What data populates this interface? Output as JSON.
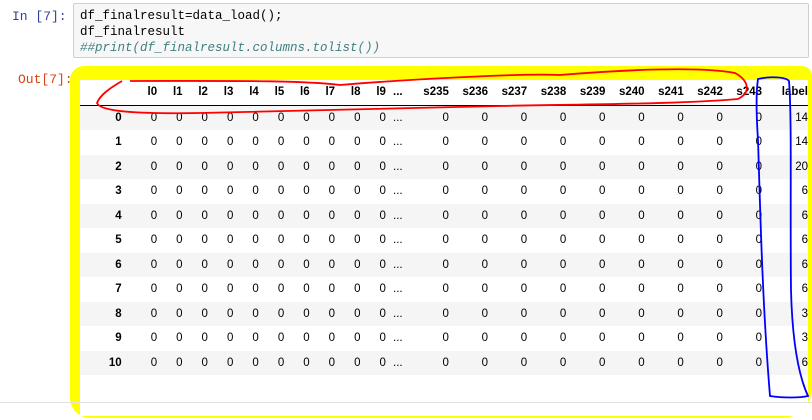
{
  "input_cell": {
    "prompt": "In  [7]:",
    "lines": [
      "df_finalresult=data_load();",
      "df_finalresult",
      "##print(df_finalresult.columns.tolist())"
    ]
  },
  "output_cell": {
    "prompt": "Out[7]:"
  },
  "dataframe": {
    "columns": [
      "l0",
      "l1",
      "l2",
      "l3",
      "l4",
      "l5",
      "l6",
      "l7",
      "l8",
      "l9",
      "...",
      "s235",
      "s236",
      "s237",
      "s238",
      "s239",
      "s240",
      "s241",
      "s242",
      "s243",
      "label"
    ],
    "index": [
      "0",
      "1",
      "2",
      "3",
      "4",
      "5",
      "6",
      "7",
      "8",
      "9",
      "10"
    ],
    "rows": [
      [
        "0",
        "0",
        "0",
        "0",
        "0",
        "0",
        "0",
        "0",
        "0",
        "0",
        "...",
        "0",
        "0",
        "0",
        "0",
        "0",
        "0",
        "0",
        "0",
        "0",
        "14"
      ],
      [
        "0",
        "0",
        "0",
        "0",
        "0",
        "0",
        "0",
        "0",
        "0",
        "0",
        "...",
        "0",
        "0",
        "0",
        "0",
        "0",
        "0",
        "0",
        "0",
        "0",
        "14"
      ],
      [
        "0",
        "0",
        "0",
        "0",
        "0",
        "0",
        "0",
        "0",
        "0",
        "0",
        "...",
        "0",
        "0",
        "0",
        "0",
        "0",
        "0",
        "0",
        "0",
        "0",
        "20"
      ],
      [
        "0",
        "0",
        "0",
        "0",
        "0",
        "0",
        "0",
        "0",
        "0",
        "0",
        "...",
        "0",
        "0",
        "0",
        "0",
        "0",
        "0",
        "0",
        "0",
        "0",
        "6"
      ],
      [
        "0",
        "0",
        "0",
        "0",
        "0",
        "0",
        "0",
        "0",
        "0",
        "0",
        "...",
        "0",
        "0",
        "0",
        "0",
        "0",
        "0",
        "0",
        "0",
        "0",
        "6"
      ],
      [
        "0",
        "0",
        "0",
        "0",
        "0",
        "0",
        "0",
        "0",
        "0",
        "0",
        "...",
        "0",
        "0",
        "0",
        "0",
        "0",
        "0",
        "0",
        "0",
        "0",
        "6"
      ],
      [
        "0",
        "0",
        "0",
        "0",
        "0",
        "0",
        "0",
        "0",
        "0",
        "0",
        "...",
        "0",
        "0",
        "0",
        "0",
        "0",
        "0",
        "0",
        "0",
        "0",
        "6"
      ],
      [
        "0",
        "0",
        "0",
        "0",
        "0",
        "0",
        "0",
        "0",
        "0",
        "0",
        "...",
        "0",
        "0",
        "0",
        "0",
        "0",
        "0",
        "0",
        "0",
        "0",
        "6"
      ],
      [
        "0",
        "0",
        "0",
        "0",
        "0",
        "0",
        "0",
        "0",
        "0",
        "0",
        "...",
        "0",
        "0",
        "0",
        "0",
        "0",
        "0",
        "0",
        "0",
        "0",
        "3"
      ],
      [
        "0",
        "0",
        "0",
        "0",
        "0",
        "0",
        "0",
        "0",
        "0",
        "0",
        "...",
        "0",
        "0",
        "0",
        "0",
        "0",
        "0",
        "0",
        "0",
        "0",
        "3"
      ],
      [
        "0",
        "0",
        "0",
        "0",
        "0",
        "0",
        "0",
        "0",
        "0",
        "0",
        "...",
        "0",
        "0",
        "0",
        "0",
        "0",
        "0",
        "0",
        "0",
        "0",
        "6"
      ]
    ]
  },
  "colors": {
    "highlight": "#ffff00",
    "red_annotation": "#ff0000",
    "blue_annotation": "#0000ff",
    "in_prompt": "#303f9f",
    "out_prompt": "#d84315",
    "comment": "#408080"
  }
}
